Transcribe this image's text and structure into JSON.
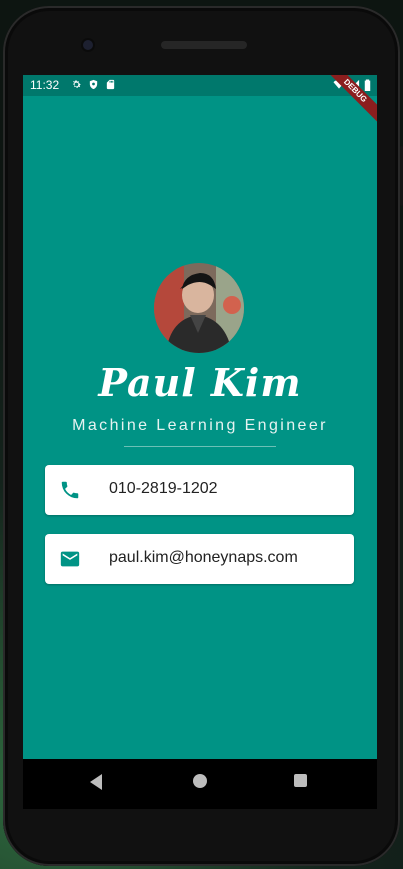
{
  "status_bar": {
    "time": "11:32",
    "debug_label": "DEBUG"
  },
  "profile": {
    "name": "Paul Kim",
    "title": "Machine Learning Engineer"
  },
  "contacts": [
    {
      "icon": "phone-icon",
      "value": "010-2819-1202"
    },
    {
      "icon": "mail-icon",
      "value": "paul.kim@honeynaps.com"
    }
  ],
  "colors": {
    "background": "#009385",
    "status_bar": "#00786c",
    "card": "#ffffff",
    "icon": "#009385"
  }
}
